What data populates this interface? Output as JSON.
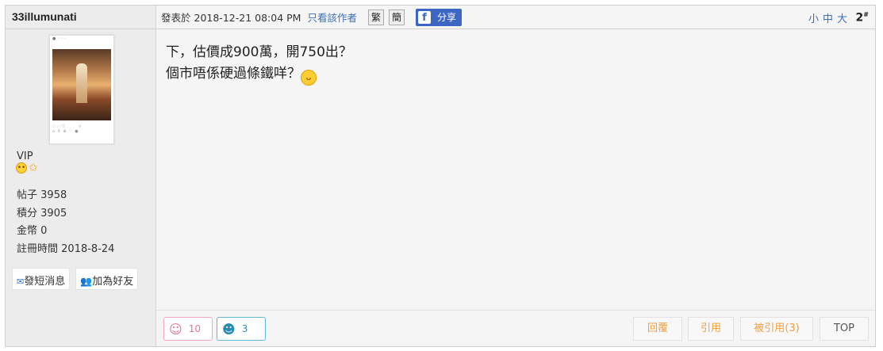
{
  "author": {
    "username": "33illumunati",
    "rank": "VIP",
    "rank_icons": [
      "smiley-icon",
      "star-icon"
    ],
    "stats": [
      {
        "label": "帖子",
        "value": "3958"
      },
      {
        "label": "積分",
        "value": "3905"
      },
      {
        "label": "金幣",
        "value": "0"
      },
      {
        "label": "註冊時間",
        "value": "2018-8-24"
      }
    ],
    "actions": {
      "message_label": "發短消息",
      "add_friend_label": "加為好友"
    }
  },
  "post": {
    "posted_prefix": "發表於",
    "posted_at": "2018-12-21 08:04 PM",
    "only_author": "只看該作者",
    "trad_label": "繁",
    "simp_label": "簡",
    "share_label": "分享",
    "font_sizes": "小中大",
    "floor": "2",
    "floor_suffix": "#",
    "lines": [
      "下，估價成900萬，開750出？",
      "個市唔係硬過條鐵咩？"
    ]
  },
  "footer": {
    "reactions": [
      {
        "icon": "love-face-icon",
        "count": "10"
      },
      {
        "icon": "pig-face-icon",
        "count": "3"
      }
    ],
    "reply_label": "回覆",
    "quote_label": "引用",
    "quoted_label": "被引用(3)",
    "top_label": "TOP"
  },
  "colors": {
    "link": "#3b6fb6",
    "facebook": "#3b66c4",
    "action_orange": "#f0a040"
  }
}
